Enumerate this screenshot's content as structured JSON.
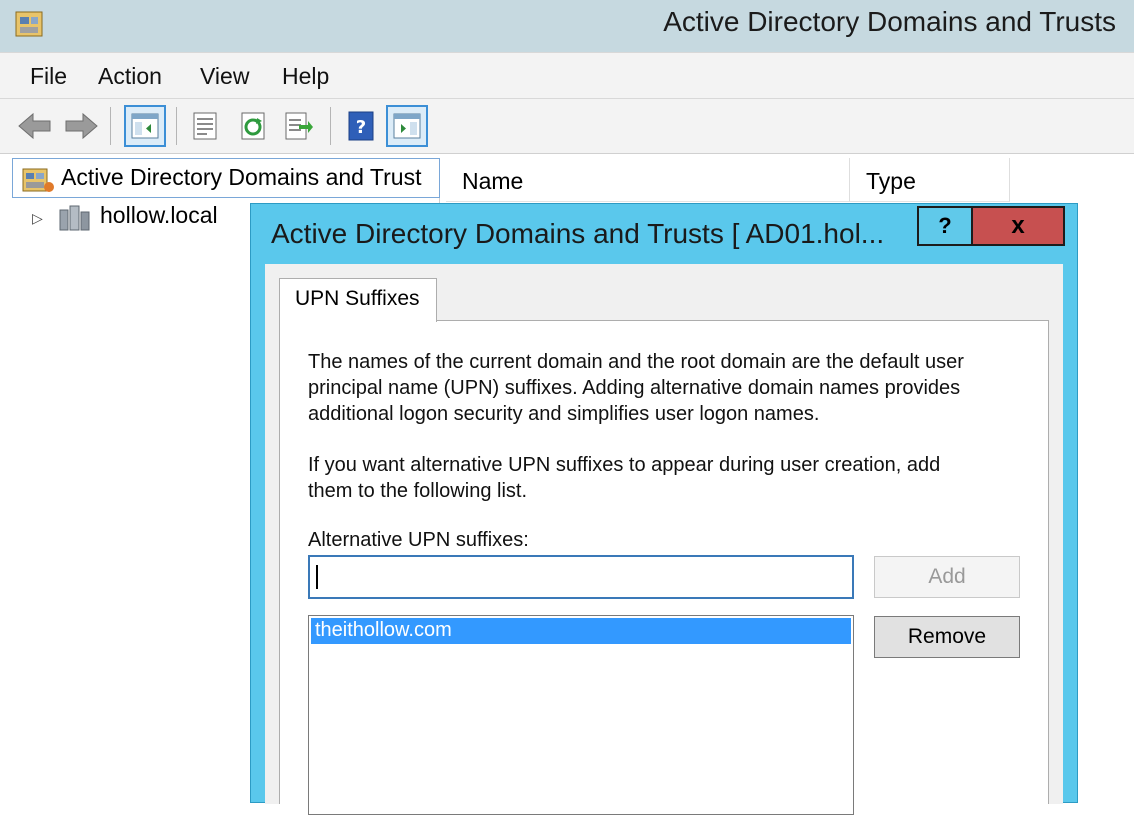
{
  "window": {
    "title": "Active Directory Domains and Trusts"
  },
  "menu": {
    "file": "File",
    "action": "Action",
    "view": "View",
    "help": "Help"
  },
  "toolbar": {
    "icons": [
      "back-arrow-icon",
      "forward-arrow-icon",
      "show-hide-tree-icon",
      "properties-icon",
      "refresh-icon",
      "export-list-icon",
      "help-icon",
      "show-hide-action-pane-icon"
    ]
  },
  "tree": {
    "root_label": "Active Directory Domains and Trust",
    "child_label": "hollow.local"
  },
  "list": {
    "columns": [
      "Name",
      "Type"
    ]
  },
  "dialog": {
    "title": "Active Directory Domains and Trusts [ AD01.hol...",
    "help_label": "?",
    "close_label": "x",
    "tab_label": "UPN Suffixes",
    "description_lines": [
      "The names of the current domain and the root domain are the default user",
      "principal name (UPN) suffixes. Adding alternative domain names provides",
      "additional logon security and simplifies user logon names."
    ],
    "instruction_lines": [
      "If you want alternative UPN suffixes to appear during user creation, add",
      "them to the following list."
    ],
    "alt_label": "Alternative UPN suffixes:",
    "input_value": "",
    "add_label": "Add",
    "remove_label": "Remove",
    "suffixes": [
      "theithollow.com"
    ]
  },
  "colors": {
    "dialog_frame": "#5ac8ec",
    "close_button": "#c75050",
    "selection": "#3399ff",
    "titlebar": "#c6d9e0"
  }
}
